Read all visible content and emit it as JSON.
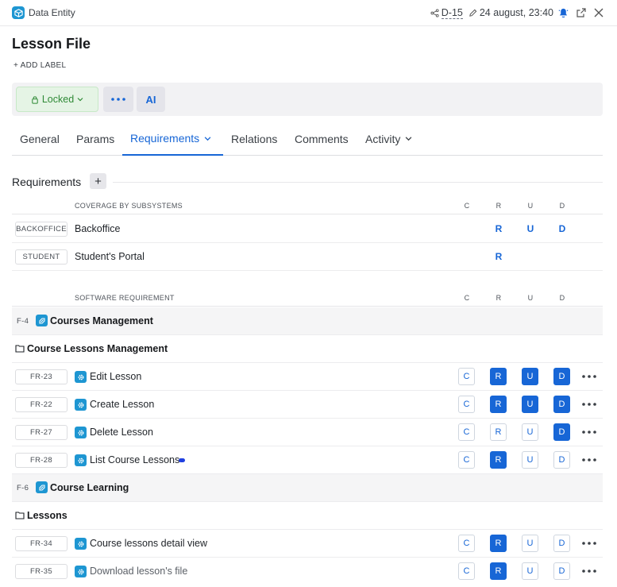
{
  "topbar": {
    "entity_type": "Data Entity",
    "code": "D-15",
    "date": "24 august, 23:40"
  },
  "header": {
    "title": "Lesson File",
    "add_label": "+ ADD LABEL"
  },
  "actions": {
    "locked_label": "Locked",
    "ai_label": "AI"
  },
  "tabs": [
    {
      "label": "General"
    },
    {
      "label": "Params"
    },
    {
      "label": "Requirements"
    },
    {
      "label": "Relations"
    },
    {
      "label": "Comments"
    },
    {
      "label": "Activity"
    }
  ],
  "requirements": {
    "heading": "Requirements",
    "add_symbol": "+",
    "coverage": {
      "header": "COVERAGE BY SUBSYSTEMS",
      "cols": [
        "C",
        "R",
        "U",
        "D"
      ],
      "rows": [
        {
          "tag": "BACKOFFICE",
          "name": "Backoffice",
          "r": "R",
          "u": "U",
          "d": "D"
        },
        {
          "tag": "STUDENT",
          "name": "Student's Portal",
          "r": "R"
        }
      ]
    },
    "software": {
      "header": "SOFTWARE REQUIREMENT",
      "cols": [
        "C",
        "R",
        "U",
        "D"
      ],
      "groups": [
        {
          "code": "F-4",
          "name": "Courses Management",
          "folder": "Course Lessons Management",
          "items": [
            {
              "code": "FR-23",
              "name": "Edit Lesson",
              "crud": {
                "c": false,
                "r": true,
                "u": true,
                "d": true
              }
            },
            {
              "code": "FR-22",
              "name": "Create Lesson",
              "crud": {
                "c": false,
                "r": true,
                "u": true,
                "d": true
              }
            },
            {
              "code": "FR-27",
              "name": "Delete Lesson",
              "crud": {
                "c": false,
                "r": false,
                "u": false,
                "d": true
              }
            },
            {
              "code": "FR-28",
              "name": "List Course Lessons",
              "crud": {
                "c": false,
                "r": true,
                "u": false,
                "d": false
              }
            }
          ]
        },
        {
          "code": "F-6",
          "name": "Course Learning",
          "folder": "Lessons",
          "items": [
            {
              "code": "FR-34",
              "name": "Course lessons detail view",
              "crud": {
                "c": false,
                "r": true,
                "u": false,
                "d": false
              }
            },
            {
              "code": "FR-35",
              "name": "Download lesson's file",
              "crud": {
                "c": false,
                "r": true,
                "u": false,
                "d": false
              }
            }
          ]
        }
      ]
    }
  },
  "colors": {
    "accent": "#1766d6",
    "locked_green": "#2f8a36",
    "entity_icon": "#1e96d2",
    "alert": "#1766d6"
  },
  "icons": {
    "entity": "cube-icon",
    "share": "share-icon",
    "edit": "pencil-icon",
    "bell": "bell-icon",
    "open": "external-link-icon",
    "close": "close-icon"
  }
}
